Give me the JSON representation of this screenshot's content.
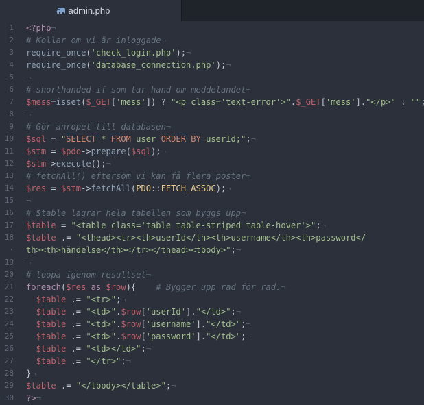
{
  "tab": {
    "title": "admin.php",
    "icon": "php-elephant-icon"
  },
  "colors": {
    "background": "#2b303b",
    "keyword": "#b48ead",
    "function": "#8fa1b3",
    "variable": "#bf616a",
    "string": "#a3be8c",
    "comment": "#65737e"
  },
  "lines": [
    {
      "n": "1",
      "t": [
        [
          "kw",
          "<?php"
        ],
        [
          "inv",
          "¬"
        ]
      ]
    },
    {
      "n": "2",
      "t": [
        [
          "cm",
          "# Kollar om vi är inloggade"
        ],
        [
          "inv",
          "¬"
        ]
      ]
    },
    {
      "n": "3",
      "t": [
        [
          "fn",
          "require_once"
        ],
        [
          "op",
          "("
        ],
        [
          "str",
          "'check_login.php'"
        ],
        [
          "op",
          ");"
        ],
        [
          "inv",
          "¬"
        ]
      ]
    },
    {
      "n": "4",
      "t": [
        [
          "fn",
          "require_once"
        ],
        [
          "op",
          "("
        ],
        [
          "str",
          "'database_connection.php'"
        ],
        [
          "op",
          ");"
        ],
        [
          "inv",
          "¬"
        ]
      ]
    },
    {
      "n": "5",
      "t": [
        [
          "inv",
          "¬"
        ]
      ]
    },
    {
      "n": "6",
      "t": [
        [
          "cm",
          "# shorthanded if som tar hand om meddelandet"
        ],
        [
          "inv",
          "¬"
        ]
      ]
    },
    {
      "n": "7",
      "t": [
        [
          "var",
          "$mess"
        ],
        [
          "op",
          "="
        ],
        [
          "fn",
          "isset"
        ],
        [
          "op",
          "("
        ],
        [
          "var",
          "$_GET"
        ],
        [
          "op",
          "["
        ],
        [
          "str",
          "'mess'"
        ],
        [
          "op",
          "]) ? "
        ],
        [
          "str",
          "\"<p class='text-error'>\""
        ],
        [
          "op",
          "."
        ],
        [
          "var",
          "$_GET"
        ],
        [
          "op",
          "["
        ],
        [
          "str",
          "'mess'"
        ],
        [
          "op",
          "]."
        ],
        [
          "str",
          "\"</p>\""
        ],
        [
          "op",
          " : "
        ],
        [
          "str",
          "\"\""
        ],
        [
          "op",
          ";"
        ]
      ]
    },
    {
      "n": "8",
      "t": [
        [
          "inv",
          "¬"
        ]
      ]
    },
    {
      "n": "9",
      "t": [
        [
          "cm",
          "# Gör anropet till databasen"
        ],
        [
          "inv",
          "¬"
        ]
      ]
    },
    {
      "n": "10",
      "t": [
        [
          "var",
          "$sql"
        ],
        [
          "op",
          " = "
        ],
        [
          "str",
          "\""
        ],
        [
          "sql",
          "SELECT"
        ],
        [
          "str",
          " * "
        ],
        [
          "sql",
          "FROM"
        ],
        [
          "str",
          " user "
        ],
        [
          "sql",
          "ORDER BY"
        ],
        [
          "str",
          " userId;\""
        ],
        [
          "op",
          ";"
        ],
        [
          "inv",
          "¬"
        ]
      ]
    },
    {
      "n": "11",
      "t": [
        [
          "var",
          "$stm"
        ],
        [
          "op",
          " = "
        ],
        [
          "var",
          "$pdo"
        ],
        [
          "op",
          "->"
        ],
        [
          "fn",
          "prepare"
        ],
        [
          "op",
          "("
        ],
        [
          "var",
          "$sql"
        ],
        [
          "op",
          ");"
        ],
        [
          "inv",
          "¬"
        ]
      ]
    },
    {
      "n": "12",
      "t": [
        [
          "var",
          "$stm"
        ],
        [
          "op",
          "->"
        ],
        [
          "fn",
          "execute"
        ],
        [
          "op",
          "();"
        ],
        [
          "inv",
          "¬"
        ]
      ]
    },
    {
      "n": "13",
      "t": [
        [
          "cm",
          "# fetchAll() eftersom vi kan få flera poster"
        ],
        [
          "inv",
          "¬"
        ]
      ]
    },
    {
      "n": "14",
      "t": [
        [
          "var",
          "$res"
        ],
        [
          "op",
          " = "
        ],
        [
          "var",
          "$stm"
        ],
        [
          "op",
          "->"
        ],
        [
          "fn",
          "fetchAll"
        ],
        [
          "op",
          "("
        ],
        [
          "cls",
          "PDO"
        ],
        [
          "op",
          "::"
        ],
        [
          "cls",
          "FETCH_ASSOC"
        ],
        [
          "op",
          ");"
        ],
        [
          "inv",
          "¬"
        ]
      ]
    },
    {
      "n": "15",
      "t": [
        [
          "inv",
          "¬"
        ]
      ]
    },
    {
      "n": "16",
      "t": [
        [
          "cm",
          "# $table lagrar hela tabellen som byggs upp"
        ],
        [
          "inv",
          "¬"
        ]
      ]
    },
    {
      "n": "17",
      "t": [
        [
          "var",
          "$table"
        ],
        [
          "op",
          " = "
        ],
        [
          "str",
          "\"<table class='table table-striped table-hover'>\""
        ],
        [
          "op",
          ";"
        ],
        [
          "inv",
          "¬"
        ]
      ]
    },
    {
      "n": "18",
      "t": [
        [
          "var",
          "$table"
        ],
        [
          "op",
          " .= "
        ],
        [
          "str",
          "\"<thead><tr><th>userId</th><th>username</th><th>password</"
        ]
      ]
    },
    {
      "n": "·",
      "t": [
        [
          "str",
          "th><th>händelse</th></tr></thead><tbody>\""
        ],
        [
          "op",
          ";"
        ],
        [
          "inv",
          "¬"
        ]
      ]
    },
    {
      "n": "19",
      "t": [
        [
          "inv",
          "¬"
        ]
      ]
    },
    {
      "n": "20",
      "t": [
        [
          "cm",
          "# loopa igenom resultset"
        ],
        [
          "inv",
          "¬"
        ]
      ]
    },
    {
      "n": "21",
      "t": [
        [
          "kw",
          "foreach"
        ],
        [
          "op",
          "("
        ],
        [
          "var",
          "$res"
        ],
        [
          "op",
          " "
        ],
        [
          "kw",
          "as"
        ],
        [
          "op",
          " "
        ],
        [
          "var",
          "$row"
        ],
        [
          "op",
          "){    "
        ],
        [
          "cm",
          "# Bygger upp rad för rad."
        ],
        [
          "inv",
          "¬"
        ]
      ]
    },
    {
      "n": "22",
      "t": [
        [
          "inv",
          "  "
        ],
        [
          "var",
          "$table"
        ],
        [
          "op",
          " .= "
        ],
        [
          "str",
          "\"<tr>\""
        ],
        [
          "op",
          ";"
        ],
        [
          "inv",
          "¬"
        ]
      ]
    },
    {
      "n": "23",
      "t": [
        [
          "inv",
          "  "
        ],
        [
          "var",
          "$table"
        ],
        [
          "op",
          " .= "
        ],
        [
          "str",
          "\"<td>\""
        ],
        [
          "op",
          "."
        ],
        [
          "var",
          "$row"
        ],
        [
          "op",
          "["
        ],
        [
          "str",
          "'userId'"
        ],
        [
          "op",
          "]."
        ],
        [
          "str",
          "\"</td>\""
        ],
        [
          "op",
          ";"
        ],
        [
          "inv",
          "¬"
        ]
      ]
    },
    {
      "n": "24",
      "t": [
        [
          "inv",
          "  "
        ],
        [
          "var",
          "$table"
        ],
        [
          "op",
          " .= "
        ],
        [
          "str",
          "\"<td>\""
        ],
        [
          "op",
          "."
        ],
        [
          "var",
          "$row"
        ],
        [
          "op",
          "["
        ],
        [
          "str",
          "'username'"
        ],
        [
          "op",
          "]."
        ],
        [
          "str",
          "\"</td>\""
        ],
        [
          "op",
          ";"
        ],
        [
          "inv",
          "¬"
        ]
      ]
    },
    {
      "n": "25",
      "t": [
        [
          "inv",
          "  "
        ],
        [
          "var",
          "$table"
        ],
        [
          "op",
          " .= "
        ],
        [
          "str",
          "\"<td>\""
        ],
        [
          "op",
          "."
        ],
        [
          "var",
          "$row"
        ],
        [
          "op",
          "["
        ],
        [
          "str",
          "'password'"
        ],
        [
          "op",
          "]."
        ],
        [
          "str",
          "\"</td>\""
        ],
        [
          "op",
          ";"
        ],
        [
          "inv",
          "¬"
        ]
      ]
    },
    {
      "n": "26",
      "t": [
        [
          "inv",
          "  "
        ],
        [
          "var",
          "$table"
        ],
        [
          "op",
          " .= "
        ],
        [
          "str",
          "\"<td></td>\""
        ],
        [
          "op",
          ";"
        ],
        [
          "inv",
          "¬"
        ]
      ]
    },
    {
      "n": "27",
      "t": [
        [
          "inv",
          "  "
        ],
        [
          "var",
          "$table"
        ],
        [
          "op",
          " .= "
        ],
        [
          "str",
          "\"</tr>\""
        ],
        [
          "op",
          ";"
        ],
        [
          "inv",
          "¬"
        ]
      ]
    },
    {
      "n": "28",
      "t": [
        [
          "op",
          "}"
        ],
        [
          "inv",
          "¬"
        ]
      ]
    },
    {
      "n": "29",
      "t": [
        [
          "var",
          "$table"
        ],
        [
          "op",
          " .= "
        ],
        [
          "str",
          "\"</tbody></table>\""
        ],
        [
          "op",
          ";"
        ],
        [
          "inv",
          "¬"
        ]
      ]
    },
    {
      "n": "30",
      "t": [
        [
          "kw",
          "?>"
        ],
        [
          "inv",
          "¬"
        ]
      ]
    }
  ]
}
